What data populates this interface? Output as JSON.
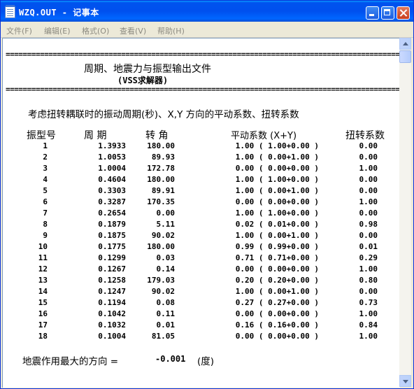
{
  "window": {
    "title": "WZQ.OUT - 记事本"
  },
  "menu": [
    "文件(F)",
    "编辑(E)",
    "格式(O)",
    "查看(V)",
    "帮助(H)"
  ],
  "doc": {
    "rule": "==============================================================================================================",
    "heading1": "周期、地震力与振型输出文件",
    "heading2": "(VSS求解器)",
    "section_title": "考虑扭转耦联时的振动周期(秒)、X,Y 方向的平动系数、扭转系数",
    "columns": [
      "振型号",
      "周 期",
      "转 角",
      "平动系数 (X+Y)",
      "扭转系数"
    ],
    "rows": [
      {
        "mode": "1",
        "period": "1.3933",
        "angle": "180.00",
        "trans": "1.00 ( 1.00+0.00 )",
        "torsion": "0.00"
      },
      {
        "mode": "2",
        "period": "1.0053",
        "angle": "89.93",
        "trans": "1.00 ( 0.00+1.00 )",
        "torsion": "0.00"
      },
      {
        "mode": "3",
        "period": "1.0004",
        "angle": "172.78",
        "trans": "0.00 ( 0.00+0.00 )",
        "torsion": "1.00"
      },
      {
        "mode": "4",
        "period": "0.4604",
        "angle": "180.00",
        "trans": "1.00 ( 1.00+0.00 )",
        "torsion": "0.00"
      },
      {
        "mode": "5",
        "period": "0.3303",
        "angle": "89.91",
        "trans": "1.00 ( 0.00+1.00 )",
        "torsion": "0.00"
      },
      {
        "mode": "6",
        "period": "0.3287",
        "angle": "170.35",
        "trans": "0.00 ( 0.00+0.00 )",
        "torsion": "1.00"
      },
      {
        "mode": "7",
        "period": "0.2654",
        "angle": "0.00",
        "trans": "1.00 ( 1.00+0.00 )",
        "torsion": "0.00"
      },
      {
        "mode": "8",
        "period": "0.1879",
        "angle": "5.11",
        "trans": "0.02 ( 0.01+0.00 )",
        "torsion": "0.98"
      },
      {
        "mode": "9",
        "period": "0.1875",
        "angle": "90.02",
        "trans": "1.00 ( 0.00+1.00 )",
        "torsion": "0.00"
      },
      {
        "mode": "10",
        "period": "0.1775",
        "angle": "180.00",
        "trans": "0.99 ( 0.99+0.00 )",
        "torsion": "0.01"
      },
      {
        "mode": "11",
        "period": "0.1299",
        "angle": "0.03",
        "trans": "0.71 ( 0.71+0.00 )",
        "torsion": "0.29"
      },
      {
        "mode": "12",
        "period": "0.1267",
        "angle": "0.14",
        "trans": "0.00 ( 0.00+0.00 )",
        "torsion": "1.00"
      },
      {
        "mode": "13",
        "period": "0.1258",
        "angle": "179.03",
        "trans": "0.20 ( 0.20+0.00 )",
        "torsion": "0.80"
      },
      {
        "mode": "14",
        "period": "0.1247",
        "angle": "90.02",
        "trans": "1.00 ( 0.00+1.00 )",
        "torsion": "0.00"
      },
      {
        "mode": "15",
        "period": "0.1194",
        "angle": "0.08",
        "trans": "0.27 ( 0.27+0.00 )",
        "torsion": "0.73"
      },
      {
        "mode": "16",
        "period": "0.1042",
        "angle": "0.11",
        "trans": "0.00 ( 0.00+0.00 )",
        "torsion": "1.00"
      },
      {
        "mode": "17",
        "period": "0.1032",
        "angle": "0.01",
        "trans": "0.16 ( 0.16+0.00 )",
        "torsion": "0.84"
      },
      {
        "mode": "18",
        "period": "0.1004",
        "angle": "81.05",
        "trans": "0.00 ( 0.00+0.00 )",
        "torsion": "1.00"
      }
    ],
    "footer_label": "地震作用最大的方向 =",
    "footer_value": "-0.001",
    "footer_unit": "(度)"
  }
}
